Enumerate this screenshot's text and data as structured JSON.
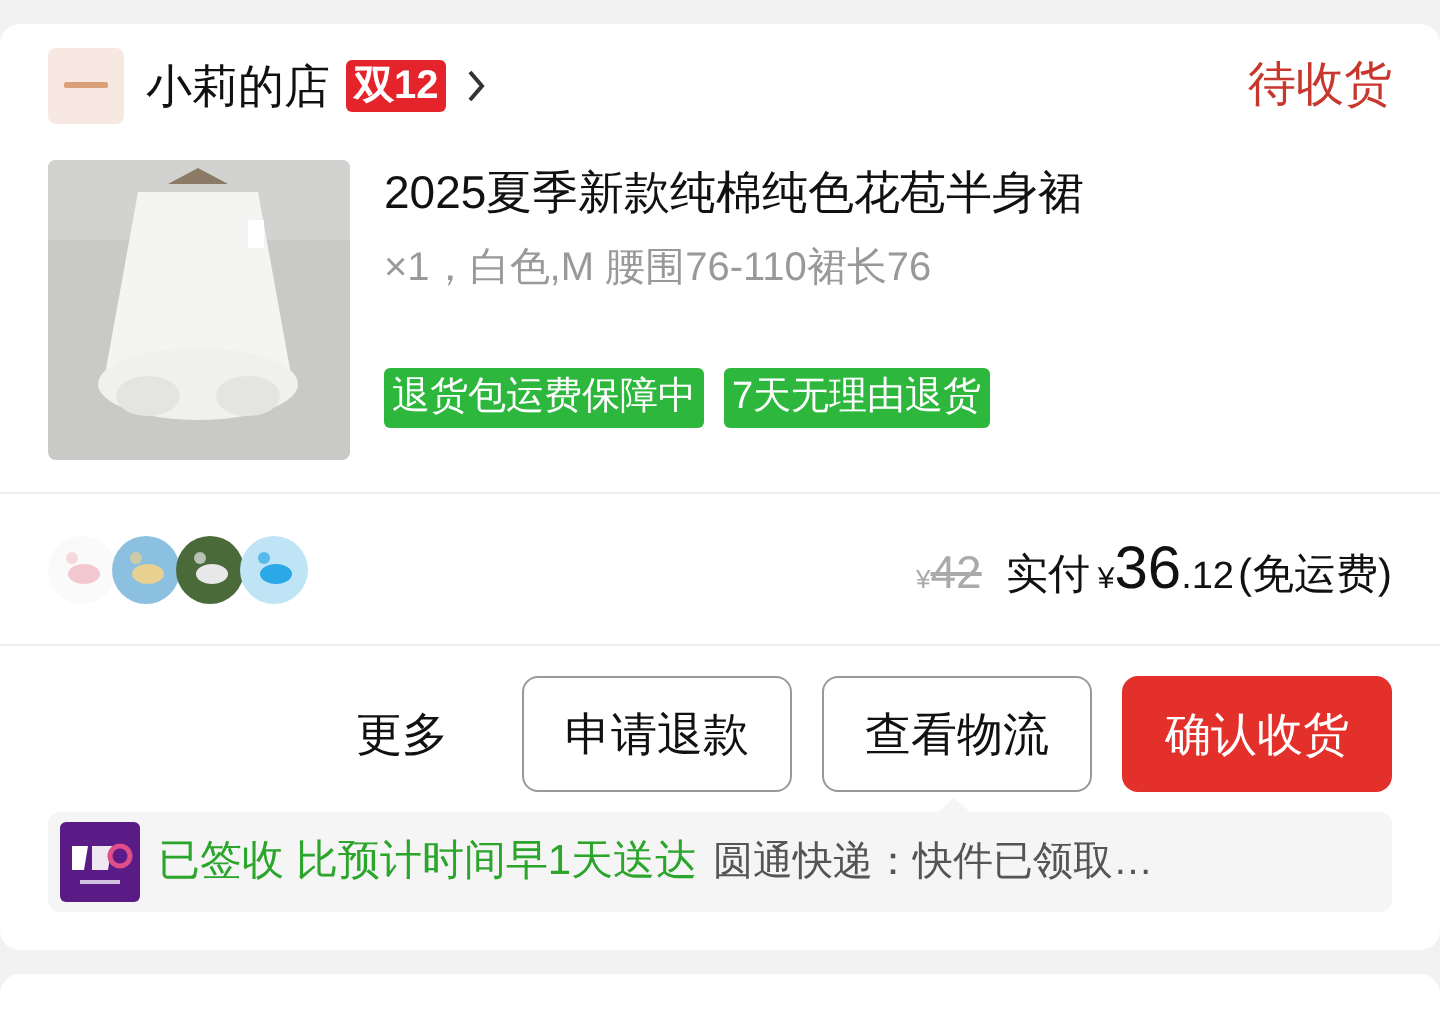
{
  "shop": {
    "name": "小莉的店",
    "badge": "双12",
    "status": "待收货"
  },
  "product": {
    "title": "2025夏季新款纯棉纯色花苞半身裙",
    "specs": "×1，白色,M 腰围76-110裙长76",
    "tags": [
      "退货包运费保障中",
      "7天无理由退货"
    ]
  },
  "price": {
    "original_currency": "¥",
    "original": "42",
    "paid_label": "实付",
    "currency": "¥",
    "integer": "36",
    "decimal": ".12",
    "note": "(免运费)"
  },
  "buttons": [
    {
      "label": "更多",
      "kind": "text"
    },
    {
      "label": "申请退款",
      "kind": "outline"
    },
    {
      "label": "查看物流",
      "kind": "outline"
    },
    {
      "label": "确认收货",
      "kind": "primary"
    }
  ],
  "logistics": {
    "status": "已签收 比预计时间早1天送达",
    "detail": "圆通快递：快件已领取…"
  }
}
